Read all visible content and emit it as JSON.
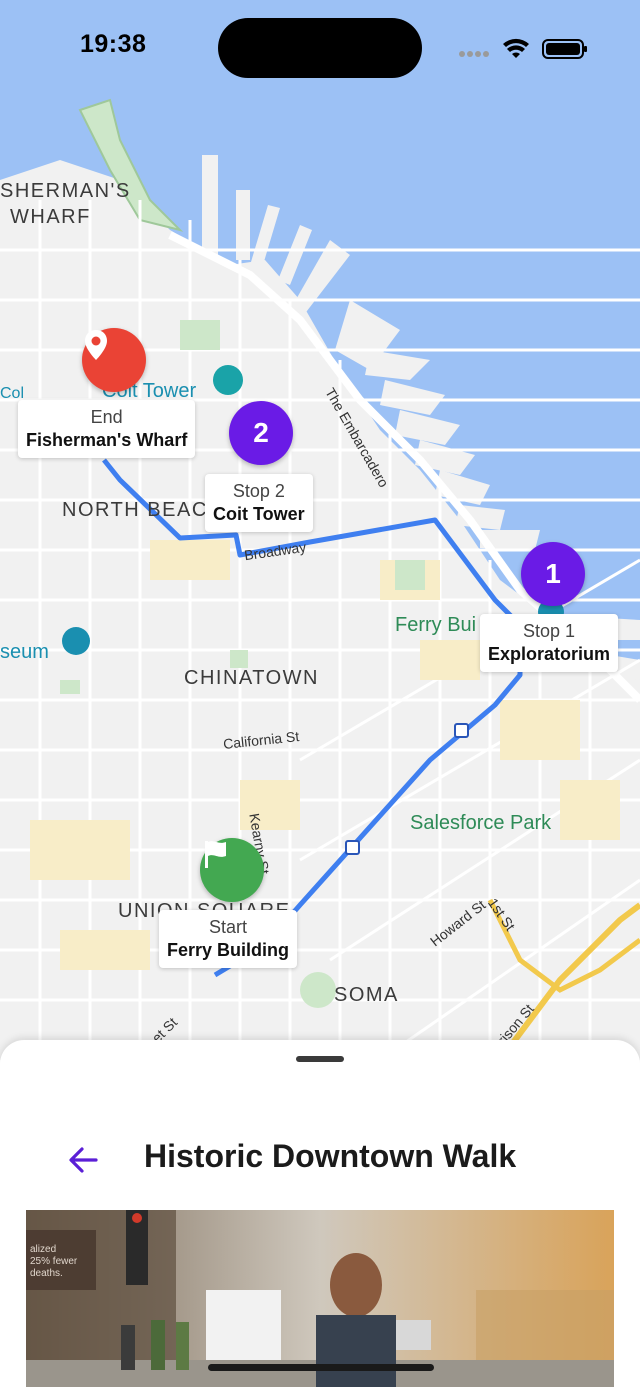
{
  "status_bar": {
    "time": "19:38"
  },
  "map": {
    "area_labels": {
      "fishermans_wharf_line1": "SHERMAN'S",
      "fishermans_wharf_line2": "WHARF",
      "north_beach": "NORTH BEAC",
      "chinatown": "CHINATOWN",
      "union_square": "UNION SQUARE",
      "soma": "SOMA"
    },
    "pois": {
      "coit_tower": "Coit Tower",
      "ferry_building": "Ferry Bui",
      "salesforce_park": "Salesforce Park",
      "museum": "seum",
      "col": "Col"
    },
    "streets": {
      "embarcadero": "The Embarcadero",
      "broadway": "Broadway",
      "california": "California St",
      "kearny": "Kearny St",
      "howard": "Howard St",
      "first": "1st St",
      "harrison": "rrison St",
      "st_bottom": "et St"
    },
    "stops": [
      {
        "kind": "End",
        "name": "Fisherman's Wharf",
        "marker": "location-pin-icon"
      },
      {
        "kind": "Stop 2",
        "name": "Coit Tower",
        "number": "2"
      },
      {
        "kind": "Stop 1",
        "name": "Exploratorium",
        "number": "1"
      },
      {
        "kind": "Start",
        "name": "Ferry Building",
        "marker": "flag-icon"
      }
    ]
  },
  "sheet": {
    "title": "Historic Downtown Walk",
    "back_icon": "arrow-left-icon",
    "photo_sign_text": "alized\n25% fewer\ndeaths."
  },
  "colors": {
    "water": "#9cc1f5",
    "land": "#f1f1f1",
    "route": "#3f7ff0",
    "stop_purple": "#6a1be6",
    "end_red": "#ea4335",
    "start_green": "#43a851",
    "accent": "#5b1fd6"
  }
}
